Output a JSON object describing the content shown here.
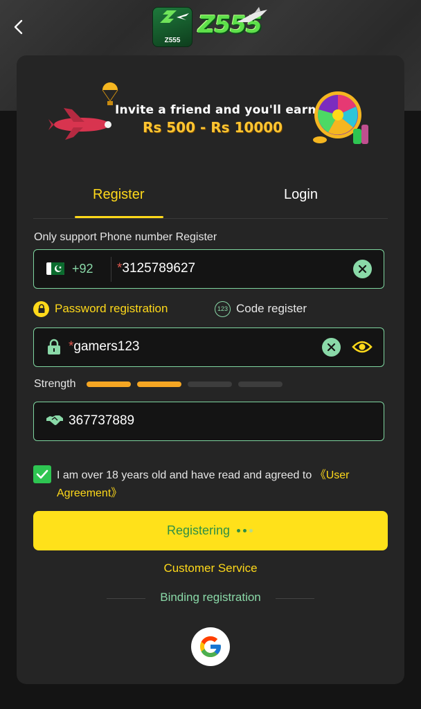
{
  "header": {
    "back_icon": "chevron-left-icon",
    "logo_badge_text": "Z555",
    "logo_text": "Z555"
  },
  "banner": {
    "line1": "Invite a friend and you'll earn",
    "line2": "Rs 500 - Rs 10000"
  },
  "tabs": [
    {
      "label": "Register",
      "active": true
    },
    {
      "label": "Login",
      "active": false
    }
  ],
  "form": {
    "hint": "Only support Phone number Register",
    "phone": {
      "country_code": "+92",
      "required_mark": "*",
      "value": "3125789627"
    },
    "modes": {
      "password_label": "Password registration",
      "code_label": "Code register",
      "code_icon_text": "123"
    },
    "password": {
      "required_mark": "*",
      "value": "gamers123"
    },
    "strength": {
      "label": "Strength",
      "level": 2,
      "total": 4
    },
    "invite_code": {
      "value": "367737889"
    },
    "agreement": {
      "checked": true,
      "text": "I am over 18 years old and have read and agreed to ",
      "link": "《User Agreement》"
    },
    "submit_label": "Registering",
    "customer_service": "Customer Service",
    "binding_label": "Binding registration"
  },
  "colors": {
    "accent_yellow": "#ffd91a",
    "accent_green": "#8ad9a8",
    "button_yellow": "#ffe11a",
    "strength_active": "#f5a623",
    "strength_inactive": "#3d3d3d",
    "check_green": "#2ec552"
  }
}
